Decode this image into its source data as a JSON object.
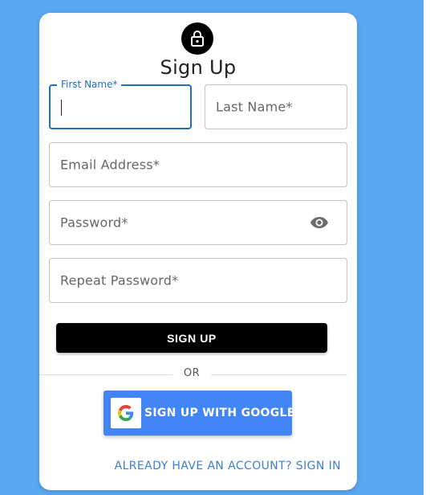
{
  "form": {
    "title": "Sign Up",
    "first_name": {
      "label": "First Name*",
      "value": ""
    },
    "last_name": {
      "placeholder": "Last Name*"
    },
    "email": {
      "placeholder": "Email Address*"
    },
    "password": {
      "placeholder": "Password*",
      "toggle_icon": "eye-icon"
    },
    "repeat_password": {
      "placeholder": "Repeat Password*"
    },
    "submit_label": "SIGN UP",
    "divider_text": "OR",
    "google_label": "SIGN UP WITH GOOGLE",
    "signin_link": "ALREADY HAVE AN ACCOUNT? SIGN IN"
  },
  "icons": {
    "header": "lock-icon",
    "google": "google-g-icon"
  },
  "colors": {
    "background": "#5aa7ef",
    "card": "#ffffff",
    "focus": "#1f6fc7",
    "primary_button": "#000000",
    "google_button": "#4285f4",
    "link": "#3d7fd0"
  }
}
